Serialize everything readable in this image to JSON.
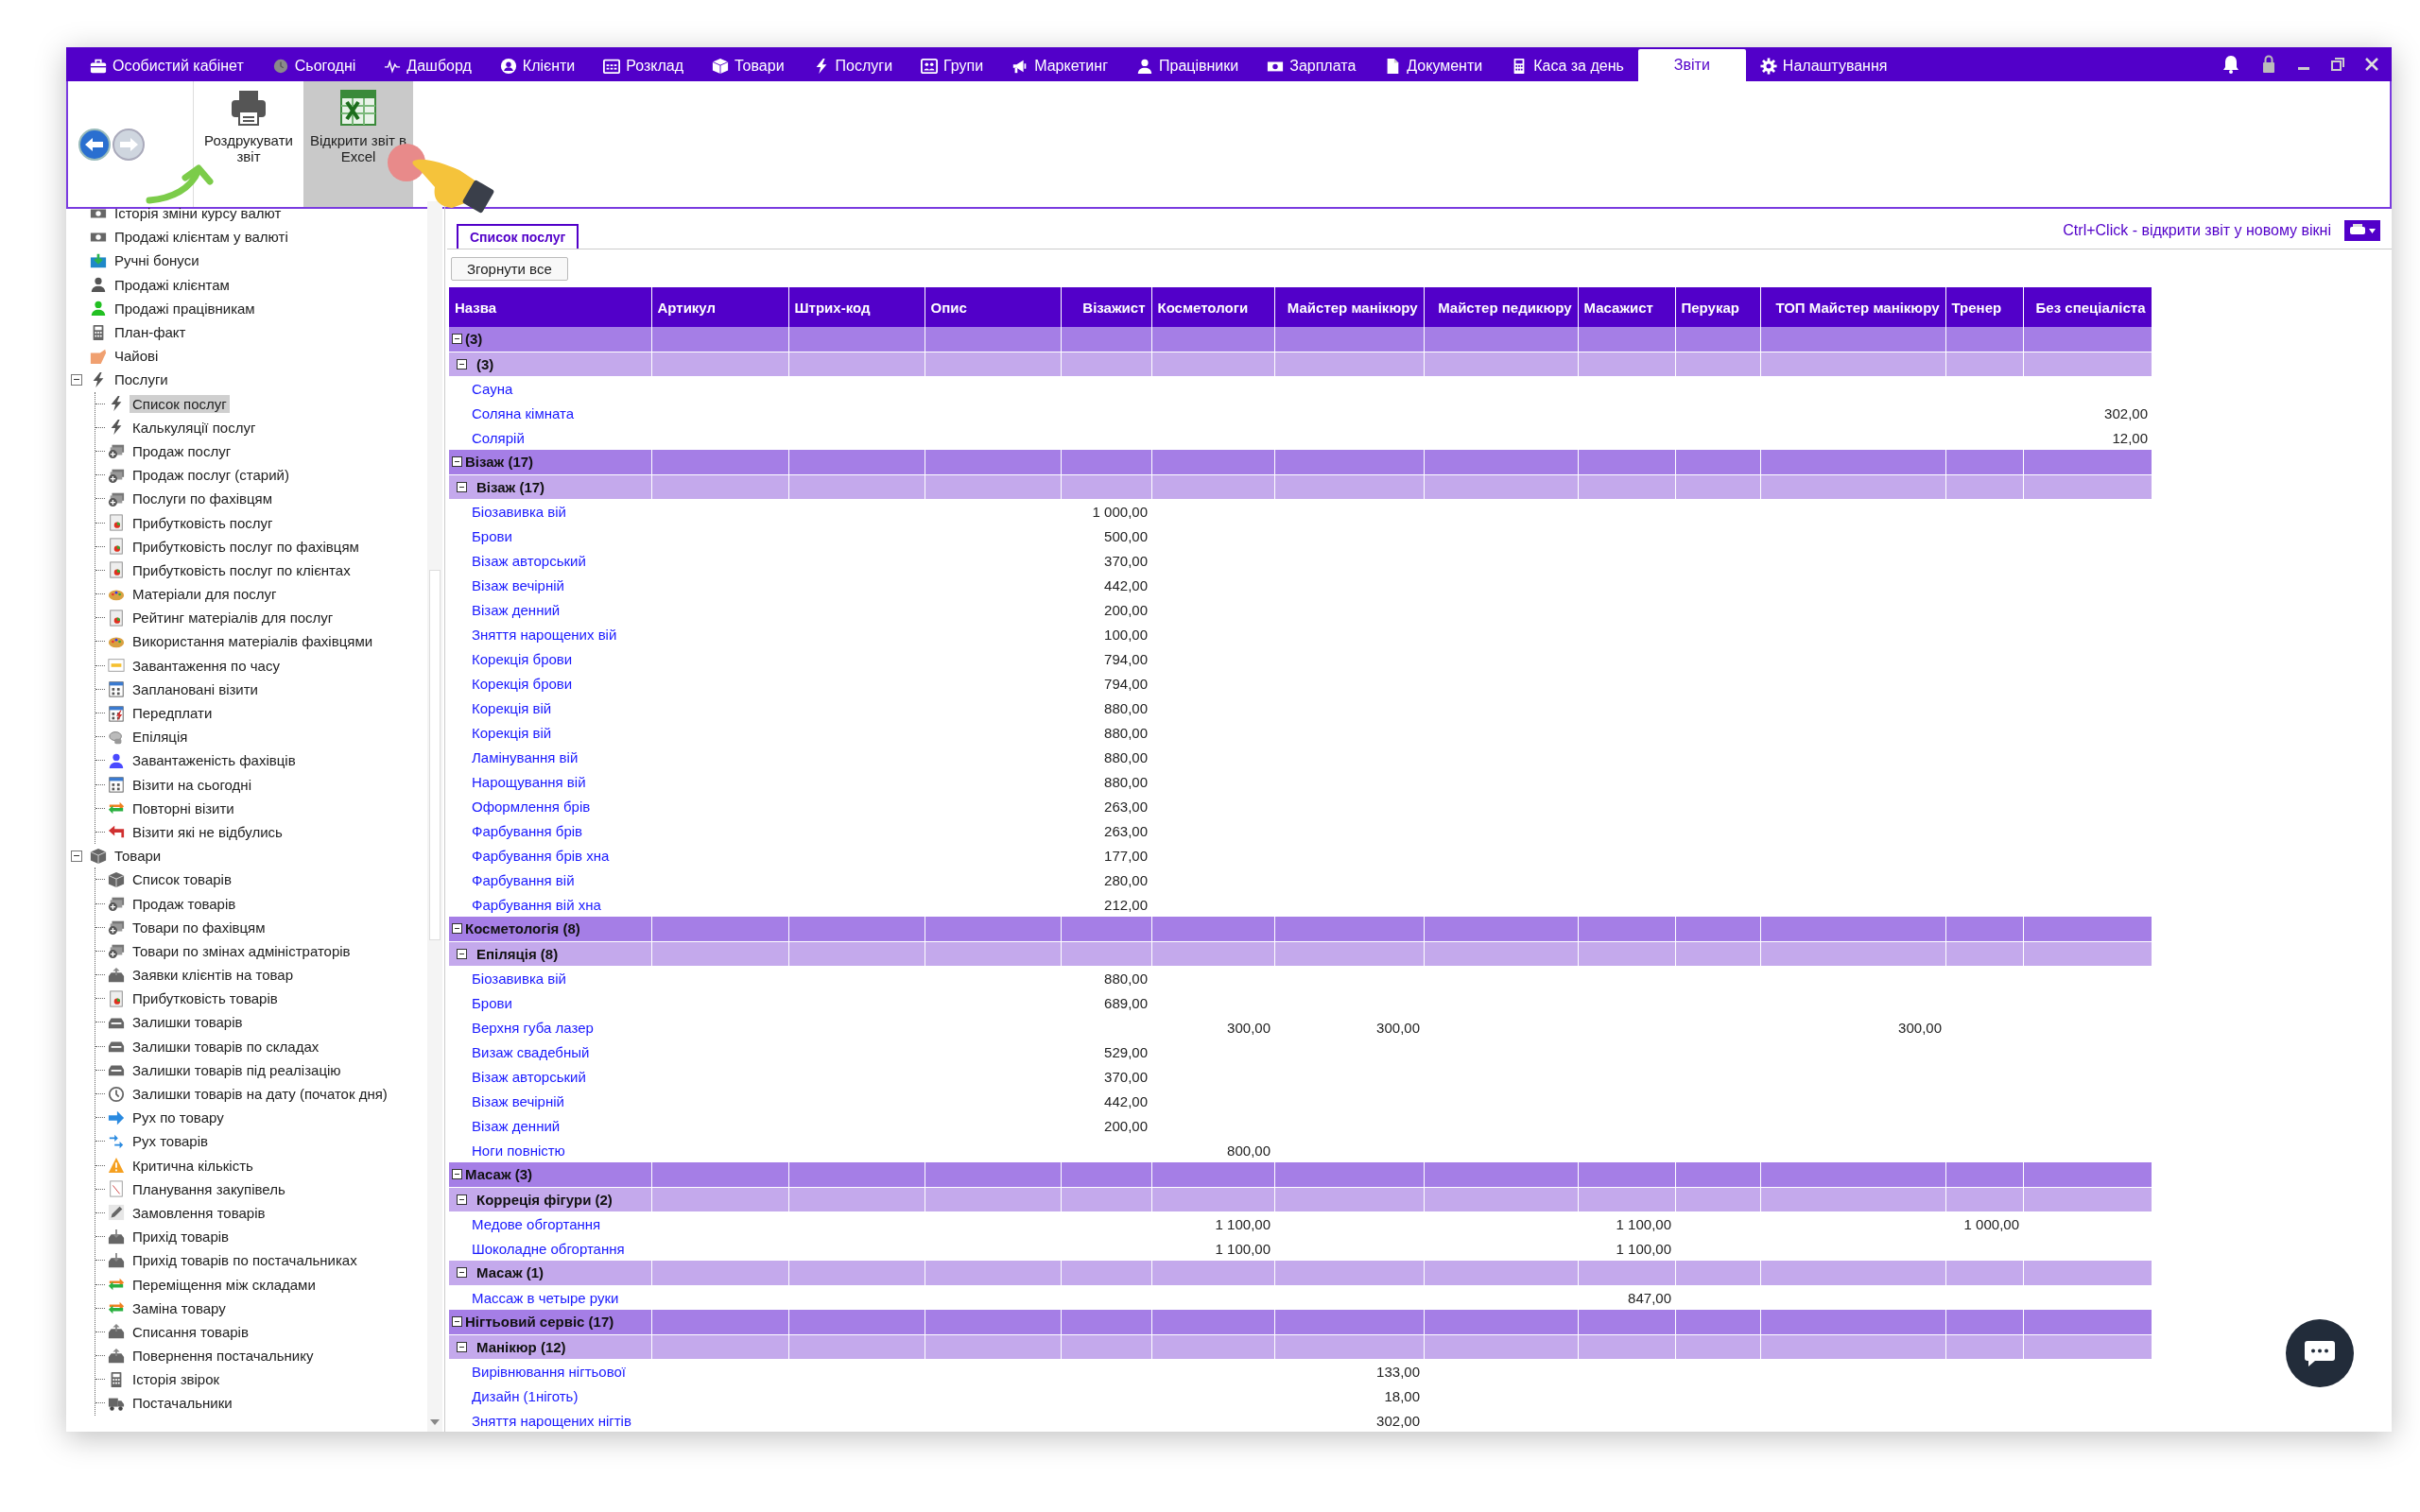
{
  "menu": [
    {
      "label": "Особистий кабінет",
      "kind": "briefcase",
      "selected": false
    },
    {
      "label": "Сьогодні",
      "kind": "clock",
      "selected": false
    },
    {
      "label": "Дашборд",
      "kind": "pulse",
      "selected": false
    },
    {
      "label": "Клієнти",
      "kind": "person-circle",
      "selected": false
    },
    {
      "label": "Розклад",
      "kind": "calendar",
      "selected": false
    },
    {
      "label": "Товари",
      "kind": "box",
      "selected": false
    },
    {
      "label": "Послуги",
      "kind": "bolt",
      "selected": false
    },
    {
      "label": "Групи",
      "kind": "group",
      "selected": false
    },
    {
      "label": "Маркетинг",
      "kind": "megaphone",
      "selected": false
    },
    {
      "label": "Працівники",
      "kind": "person",
      "selected": false
    },
    {
      "label": "Зарплата",
      "kind": "money",
      "selected": false
    },
    {
      "label": "Документи",
      "kind": "document",
      "selected": false
    },
    {
      "label": "Каса за день",
      "kind": "calculator",
      "selected": false
    },
    {
      "label": "Звіти",
      "kind": "none",
      "selected": true
    },
    {
      "label": "Налаштування",
      "kind": "gear",
      "selected": false
    }
  ],
  "toolbar": {
    "buttons": [
      {
        "label": "Роздрукувати звіт",
        "kind": "printer",
        "selected": false
      },
      {
        "label": "Відкрити звіт в Excel",
        "kind": "excel",
        "selected": true
      }
    ]
  },
  "tree": [
    {
      "label": "Історія зміни курсу валют",
      "kind": "money",
      "selected": false
    },
    {
      "label": "Продажі клієнтам у валюті",
      "kind": "money",
      "selected": false
    },
    {
      "label": "Ручні бонуси",
      "kind": "bonus",
      "selected": false
    },
    {
      "label": "Продажі клієнтам",
      "kind": "person",
      "selected": false
    },
    {
      "label": "Продажі працівникам",
      "kind": "person-green",
      "selected": false
    },
    {
      "label": "План-факт",
      "kind": "calculator",
      "selected": false
    },
    {
      "label": "Чайові",
      "kind": "hand",
      "selected": false
    },
    {
      "label": "Послуги",
      "kind": "bolt",
      "selected": false,
      "expanded": true,
      "children": [
        {
          "label": "Список послуг",
          "kind": "bolt",
          "selected": true
        },
        {
          "label": "Калькуляції послуг",
          "kind": "bolt",
          "selected": false
        },
        {
          "label": "Продаж послуг",
          "kind": "cash",
          "selected": false
        },
        {
          "label": "Продаж послуг (старий)",
          "kind": "cash",
          "selected": false
        },
        {
          "label": "Послуги по фахівцям",
          "kind": "cash",
          "selected": false
        },
        {
          "label": "Прибутковість послуг",
          "kind": "chart",
          "selected": false
        },
        {
          "label": "Прибутковість послуг по фахівцям",
          "kind": "chart",
          "selected": false
        },
        {
          "label": "Прибутковість послуг по клієнтах",
          "kind": "chart",
          "selected": false
        },
        {
          "label": "Матеріали для послуг",
          "kind": "palette",
          "selected": false
        },
        {
          "label": "Рейтинг матеріалів для послуг",
          "kind": "chart",
          "selected": false
        },
        {
          "label": "Використання матеріалів фахівцями",
          "kind": "palette",
          "selected": false
        },
        {
          "label": "Завантаження по часу",
          "kind": "grid",
          "selected": false
        },
        {
          "label": "Заплановані візити",
          "kind": "calendar",
          "selected": false
        },
        {
          "label": "Передплати",
          "kind": "calbolt",
          "selected": false
        },
        {
          "label": "Епіляція",
          "kind": "device",
          "selected": false
        },
        {
          "label": "Завантаженість фахівців",
          "kind": "person-blue",
          "selected": false
        },
        {
          "label": "Візити на сьогодні",
          "kind": "calendar",
          "selected": false
        },
        {
          "label": "Повторні візити",
          "kind": "cycle",
          "selected": false
        },
        {
          "label": "Візити які не відбулись",
          "kind": "back-red",
          "selected": false
        }
      ]
    },
    {
      "label": "Товари",
      "kind": "box",
      "selected": false,
      "expanded": true,
      "children": [
        {
          "label": "Список товарів",
          "kind": "box",
          "selected": false
        },
        {
          "label": "Продаж товарів",
          "kind": "cash",
          "selected": false
        },
        {
          "label": "Товари по фахівцям",
          "kind": "cash",
          "selected": false
        },
        {
          "label": "Товари по змінах адміністраторів",
          "kind": "cash",
          "selected": false
        },
        {
          "label": "Заявки клієнтів на товар",
          "kind": "tray-up",
          "selected": false
        },
        {
          "label": "Прибутковість товарів",
          "kind": "chart",
          "selected": false
        },
        {
          "label": "Залишки товарів",
          "kind": "tray",
          "selected": false
        },
        {
          "label": "Залишки товарів по складах",
          "kind": "tray",
          "selected": false
        },
        {
          "label": "Залишки товарів під реалізацію",
          "kind": "tray",
          "selected": false
        },
        {
          "label": "Залишки товарів на дату (початок дня)",
          "kind": "clock",
          "selected": false
        },
        {
          "label": "Рух по товару",
          "kind": "arrow-right",
          "selected": false
        },
        {
          "label": "Рух товарів",
          "kind": "arrows",
          "selected": false
        },
        {
          "label": "Критична кількість",
          "kind": "warning",
          "selected": false
        },
        {
          "label": "Планування закупівель",
          "kind": "plan",
          "selected": false
        },
        {
          "label": "Замовлення товарів",
          "kind": "pencil",
          "selected": false
        },
        {
          "label": "Прихід товарів",
          "kind": "tray-down",
          "selected": false
        },
        {
          "label": "Прихід товарів по постачальниках",
          "kind": "tray-down",
          "selected": false
        },
        {
          "label": "Переміщення між складами",
          "kind": "cycle",
          "selected": false
        },
        {
          "label": "Заміна товару",
          "kind": "cycle",
          "selected": false
        },
        {
          "label": "Списання товарів",
          "kind": "tray-up",
          "selected": false
        },
        {
          "label": "Повернення постачальнику",
          "kind": "tray-up",
          "selected": false
        },
        {
          "label": "Історія звірок",
          "kind": "calculator",
          "selected": false
        },
        {
          "label": "Постачальники",
          "kind": "truck",
          "selected": false
        }
      ]
    }
  ],
  "report_tabs": [
    {
      "label": "Список послуг",
      "selected": true
    }
  ],
  "hint": "Ctrl+Click - відкрити звіт у новому вікні",
  "collapse_all_button": "Згорнути все",
  "table": {
    "columns": [
      "Назва",
      "Артикул",
      "Штрих-код",
      "Опис",
      "Візажист",
      "Косметологи",
      "Майстер манікюру",
      "Майстер педикюру",
      "Масажист",
      "Перукар",
      "ТОП Майстер манікюру",
      "Тренер",
      "Без спеціаліста"
    ],
    "rows": [
      {
        "kind": "group1",
        "label": "(3)",
        "expanded": true
      },
      {
        "kind": "group2",
        "label": "(3)",
        "expanded": true
      },
      {
        "kind": "item",
        "label": "Сауна"
      },
      {
        "kind": "item",
        "label": "Соляна кімната",
        "cells": [
          null,
          null,
          null,
          null,
          null,
          null,
          null,
          null,
          null,
          null,
          null,
          "302,00"
        ]
      },
      {
        "kind": "item",
        "label": "Солярій",
        "cells": [
          null,
          null,
          null,
          null,
          null,
          null,
          null,
          null,
          null,
          null,
          null,
          "12,00"
        ]
      },
      {
        "kind": "group1",
        "label": "Візаж (17)",
        "expanded": true
      },
      {
        "kind": "group2",
        "label": "Візаж (17)",
        "expanded": true
      },
      {
        "kind": "item",
        "label": "Біозавивка вій",
        "cells": [
          null,
          null,
          null,
          "1 000,00",
          null,
          null,
          null,
          null,
          null,
          null,
          null,
          null
        ]
      },
      {
        "kind": "item",
        "label": "Брови",
        "cells": [
          null,
          null,
          null,
          "500,00",
          null,
          null,
          null,
          null,
          null,
          null,
          null,
          null
        ]
      },
      {
        "kind": "item",
        "label": "Візаж авторський",
        "cells": [
          null,
          null,
          null,
          "370,00",
          null,
          null,
          null,
          null,
          null,
          null,
          null,
          null
        ]
      },
      {
        "kind": "item",
        "label": "Візаж вечірній",
        "cells": [
          null,
          null,
          null,
          "442,00",
          null,
          null,
          null,
          null,
          null,
          null,
          null,
          null
        ]
      },
      {
        "kind": "item",
        "label": "Візаж денний",
        "cells": [
          null,
          null,
          null,
          "200,00",
          null,
          null,
          null,
          null,
          null,
          null,
          null,
          null
        ]
      },
      {
        "kind": "item",
        "label": "Зняття нарощених вій",
        "cells": [
          null,
          null,
          null,
          "100,00",
          null,
          null,
          null,
          null,
          null,
          null,
          null,
          null
        ]
      },
      {
        "kind": "item",
        "label": "Корекція брови",
        "cells": [
          null,
          null,
          null,
          "794,00",
          null,
          null,
          null,
          null,
          null,
          null,
          null,
          null
        ]
      },
      {
        "kind": "item",
        "label": "Корекція брови",
        "cells": [
          null,
          null,
          null,
          "794,00",
          null,
          null,
          null,
          null,
          null,
          null,
          null,
          null
        ]
      },
      {
        "kind": "item",
        "label": "Корекція вій",
        "cells": [
          null,
          null,
          null,
          "880,00",
          null,
          null,
          null,
          null,
          null,
          null,
          null,
          null
        ]
      },
      {
        "kind": "item",
        "label": "Корекція вій",
        "cells": [
          null,
          null,
          null,
          "880,00",
          null,
          null,
          null,
          null,
          null,
          null,
          null,
          null
        ]
      },
      {
        "kind": "item",
        "label": "Ламінування вій",
        "cells": [
          null,
          null,
          null,
          "880,00",
          null,
          null,
          null,
          null,
          null,
          null,
          null,
          null
        ]
      },
      {
        "kind": "item",
        "label": "Нарощування вій",
        "cells": [
          null,
          null,
          null,
          "880,00",
          null,
          null,
          null,
          null,
          null,
          null,
          null,
          null
        ]
      },
      {
        "kind": "item",
        "label": "Оформлення брів",
        "cells": [
          null,
          null,
          null,
          "263,00",
          null,
          null,
          null,
          null,
          null,
          null,
          null,
          null
        ]
      },
      {
        "kind": "item",
        "label": "Фарбування брів",
        "cells": [
          null,
          null,
          null,
          "263,00",
          null,
          null,
          null,
          null,
          null,
          null,
          null,
          null
        ]
      },
      {
        "kind": "item",
        "label": "Фарбування брів хна",
        "cells": [
          null,
          null,
          null,
          "177,00",
          null,
          null,
          null,
          null,
          null,
          null,
          null,
          null
        ]
      },
      {
        "kind": "item",
        "label": "Фарбування вій",
        "cells": [
          null,
          null,
          null,
          "280,00",
          null,
          null,
          null,
          null,
          null,
          null,
          null,
          null
        ]
      },
      {
        "kind": "item",
        "label": "Фарбування вій хна",
        "cells": [
          null,
          null,
          null,
          "212,00",
          null,
          null,
          null,
          null,
          null,
          null,
          null,
          null
        ]
      },
      {
        "kind": "group1",
        "label": "Косметологія (8)",
        "expanded": true
      },
      {
        "kind": "group2",
        "label": "Епіляція (8)",
        "expanded": true
      },
      {
        "kind": "item",
        "label": "Біозавивка вій",
        "cells": [
          null,
          null,
          null,
          "880,00",
          null,
          null,
          null,
          null,
          null,
          null,
          null,
          null
        ]
      },
      {
        "kind": "item",
        "label": "Брови",
        "cells": [
          null,
          null,
          null,
          "689,00",
          null,
          null,
          null,
          null,
          null,
          null,
          null,
          null
        ]
      },
      {
        "kind": "item",
        "label": "Верхня губа лазер",
        "cells": [
          null,
          null,
          null,
          null,
          "300,00",
          "300,00",
          null,
          null,
          null,
          "300,00",
          null,
          null
        ]
      },
      {
        "kind": "item",
        "label": "Визаж свадебный",
        "cells": [
          null,
          null,
          null,
          "529,00",
          null,
          null,
          null,
          null,
          null,
          null,
          null,
          null
        ]
      },
      {
        "kind": "item",
        "label": "Візаж авторський",
        "cells": [
          null,
          null,
          null,
          "370,00",
          null,
          null,
          null,
          null,
          null,
          null,
          null,
          null
        ]
      },
      {
        "kind": "item",
        "label": "Візаж вечірній",
        "cells": [
          null,
          null,
          null,
          "442,00",
          null,
          null,
          null,
          null,
          null,
          null,
          null,
          null
        ]
      },
      {
        "kind": "item",
        "label": "Візаж денний",
        "cells": [
          null,
          null,
          null,
          "200,00",
          null,
          null,
          null,
          null,
          null,
          null,
          null,
          null
        ]
      },
      {
        "kind": "item",
        "label": "Ноги повністю",
        "cells": [
          null,
          null,
          null,
          null,
          "800,00",
          null,
          null,
          null,
          null,
          null,
          null,
          null
        ]
      },
      {
        "kind": "group1",
        "label": "Масаж (3)",
        "expanded": true
      },
      {
        "kind": "group2",
        "label": "Корреція фігури (2)",
        "expanded": true
      },
      {
        "kind": "item",
        "label": "Медове обгортання",
        "cells": [
          null,
          null,
          null,
          null,
          "1 100,00",
          null,
          null,
          "1 100,00",
          null,
          null,
          "1 000,00",
          null
        ]
      },
      {
        "kind": "item",
        "label": "Шоколадне обгортання",
        "cells": [
          null,
          null,
          null,
          null,
          "1 100,00",
          null,
          null,
          "1 100,00",
          null,
          null,
          null,
          null
        ]
      },
      {
        "kind": "group2",
        "label": "Масаж (1)",
        "expanded": true
      },
      {
        "kind": "item",
        "label": "Массаж в четыре руки",
        "cells": [
          null,
          null,
          null,
          null,
          null,
          null,
          null,
          "847,00",
          null,
          null,
          null,
          null
        ]
      },
      {
        "kind": "group1",
        "label": "Нігтьовий сервіс (17)",
        "expanded": true
      },
      {
        "kind": "group2",
        "label": "Манікюр (12)",
        "expanded": true
      },
      {
        "kind": "item",
        "label": "Вирівнювання нігтьової",
        "cells": [
          null,
          null,
          null,
          null,
          null,
          "133,00",
          null,
          null,
          null,
          null,
          null,
          null
        ]
      },
      {
        "kind": "item",
        "label": "Дизайн (1ніготь)",
        "cells": [
          null,
          null,
          null,
          null,
          null,
          "18,00",
          null,
          null,
          null,
          null,
          null,
          null
        ]
      },
      {
        "kind": "item",
        "label": "Зняття нарощених нігтів",
        "cells": [
          null,
          null,
          null,
          null,
          null,
          "302,00",
          null,
          null,
          null,
          null,
          null,
          null
        ]
      }
    ]
  }
}
